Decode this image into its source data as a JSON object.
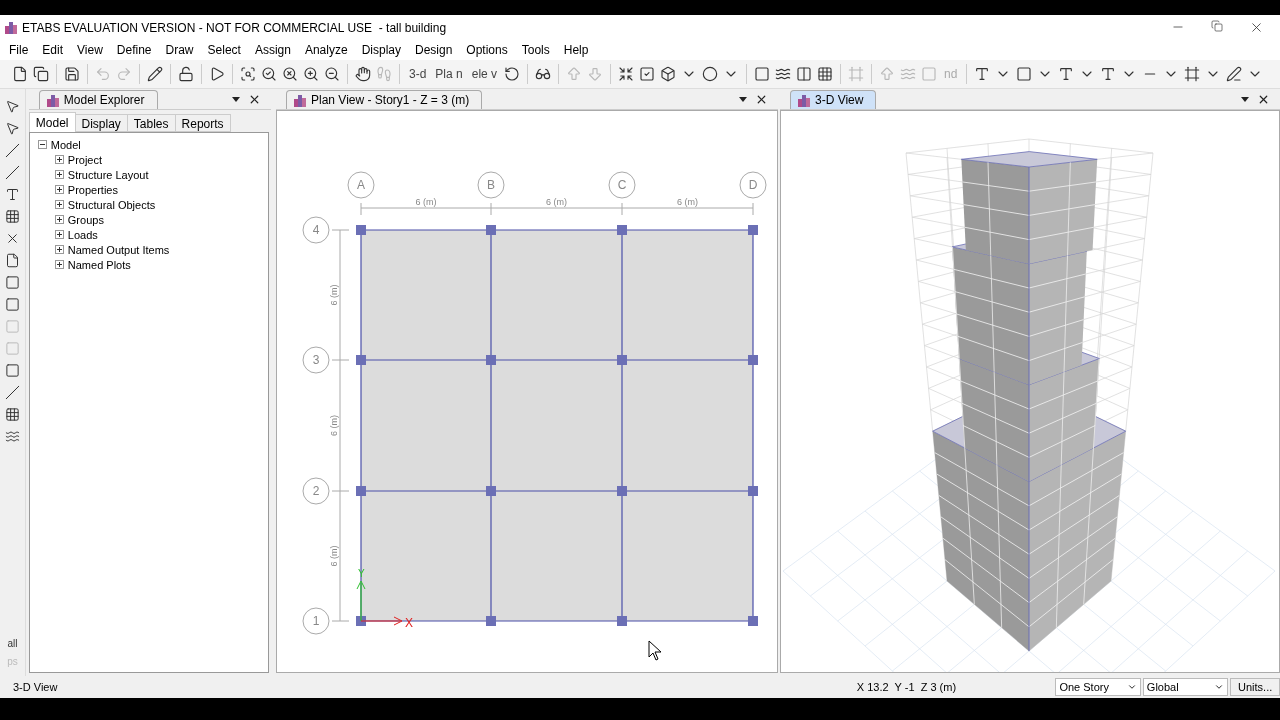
{
  "window": {
    "title": "ETABS EVALUATION VERSION - NOT FOR COMMERCIAL USE  - tall building"
  },
  "menu": [
    "File",
    "Edit",
    "View",
    "Define",
    "Draw",
    "Select",
    "Assign",
    "Analyze",
    "Display",
    "Design",
    "Options",
    "Tools",
    "Help"
  ],
  "toolbar": {
    "text_buttons": [
      "3-d",
      "Pla n",
      "ele v",
      "nd"
    ]
  },
  "left_toolbar": {
    "text_buttons": [
      "all",
      "ps"
    ]
  },
  "explorer": {
    "title": "Model Explorer",
    "tabs": [
      {
        "label": "Model",
        "selected": true
      },
      {
        "label": "Display",
        "selected": false
      },
      {
        "label": "Tables",
        "selected": false
      },
      {
        "label": "Reports",
        "selected": false
      }
    ],
    "tree": [
      {
        "label": "Model",
        "expanded": true,
        "children": [
          {
            "label": "Project",
            "expanded": false
          },
          {
            "label": "Structure Layout",
            "expanded": false
          },
          {
            "label": "Properties",
            "expanded": false
          },
          {
            "label": "Structural Objects",
            "expanded": false
          },
          {
            "label": "Groups",
            "expanded": false
          },
          {
            "label": "Loads",
            "expanded": false
          },
          {
            "label": "Named Output Items",
            "expanded": false
          },
          {
            "label": "Named Plots",
            "expanded": false
          }
        ]
      }
    ]
  },
  "plan_view": {
    "title": "Plan View - Story1 - Z = 3 (m)",
    "selected": false,
    "grid_columns": [
      "A",
      "B",
      "C",
      "D"
    ],
    "grid_rows": [
      "4",
      "3",
      "2",
      "1"
    ],
    "column_spacings": [
      "6 (m)",
      "6 (m)",
      "6 (m)"
    ],
    "row_spacings": [
      "6 (m)",
      "6 (m)",
      "6 (m)"
    ],
    "axis_x": "X",
    "axis_y": "Y"
  },
  "view_3d": {
    "title": "3-D View",
    "selected": true
  },
  "status_bar": {
    "view": "3-D View",
    "coordinates": "X 13.2  Y -1  Z 3 (m)",
    "story_select": "One Story",
    "system_select": "Global",
    "units_button": "Units..."
  }
}
